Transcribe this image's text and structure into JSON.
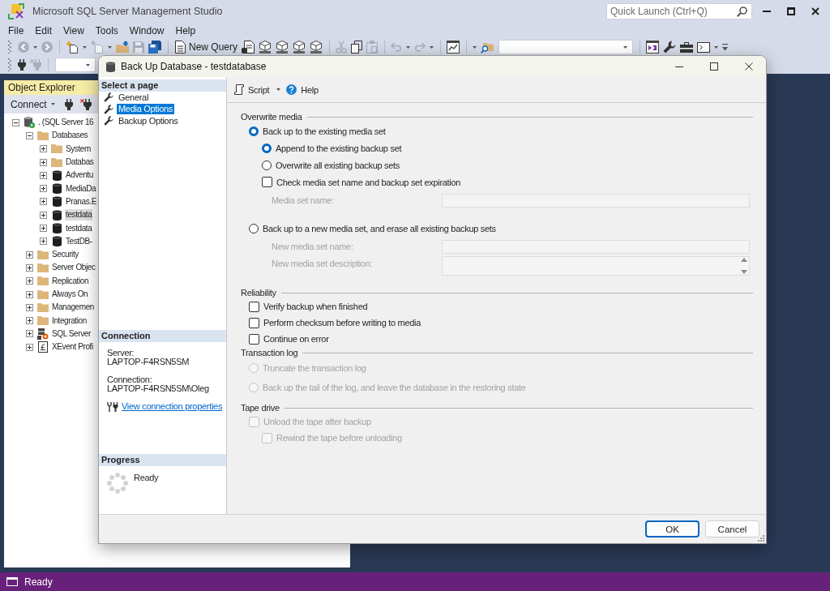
{
  "window": {
    "title": "Microsoft SQL Server Management Studio"
  },
  "quick_launch": {
    "placeholder": "Quick Launch (Ctrl+Q)"
  },
  "menu": [
    "File",
    "Edit",
    "View",
    "Tools",
    "Window",
    "Help"
  ],
  "toolbar": {
    "new_query": "New Query"
  },
  "object_explorer": {
    "title": "Object Explorer",
    "connect": "Connect",
    "tree": [
      {
        "label": ". (SQL Server 16",
        "kind": "server",
        "expanded": true,
        "selected": false,
        "children": [
          {
            "label": "Databases",
            "kind": "folder",
            "expanded": true,
            "selected": false,
            "children": [
              {
                "label": "System",
                "kind": "folder",
                "expanded": false,
                "selected": false
              },
              {
                "label": "Databas",
                "kind": "folder",
                "expanded": false,
                "selected": false
              },
              {
                "label": "Adventu",
                "kind": "database",
                "expanded": false,
                "selected": false
              },
              {
                "label": "MediaDa",
                "kind": "database",
                "expanded": false,
                "selected": false
              },
              {
                "label": "Pranas.E",
                "kind": "database",
                "expanded": false,
                "selected": false
              },
              {
                "label": "testdata",
                "kind": "database",
                "expanded": false,
                "selected": true
              },
              {
                "label": "testdata",
                "kind": "database",
                "expanded": false,
                "selected": false
              },
              {
                "label": "TestDB-",
                "kind": "database",
                "expanded": false,
                "selected": false
              }
            ]
          },
          {
            "label": "Security",
            "kind": "folder",
            "expanded": false,
            "selected": false
          },
          {
            "label": "Server Objec",
            "kind": "folder",
            "expanded": false,
            "selected": false
          },
          {
            "label": "Replication",
            "kind": "folder",
            "expanded": false,
            "selected": false
          },
          {
            "label": "Always On",
            "kind": "folder",
            "expanded": false,
            "selected": false
          },
          {
            "label": "Managemen",
            "kind": "folder",
            "expanded": false,
            "selected": false
          },
          {
            "label": "Integration",
            "kind": "folder",
            "expanded": false,
            "selected": false
          },
          {
            "label": "SQL Server",
            "kind": "agent",
            "expanded": false,
            "selected": false
          },
          {
            "label": "XEvent Profi",
            "kind": "xevent",
            "expanded": false,
            "selected": false
          }
        ]
      }
    ]
  },
  "dialog": {
    "title": "Back Up Database - testdatabase",
    "pages": {
      "heading": "Select a page",
      "items": [
        {
          "label": "General",
          "selected": false
        },
        {
          "label": "Media Options",
          "selected": true
        },
        {
          "label": "Backup Options",
          "selected": false
        }
      ]
    },
    "connection": {
      "heading": "Connection",
      "fields": [
        {
          "label": "Server:",
          "value": "LAPTOP-F4RSN5SM"
        },
        {
          "label": "Connection:",
          "value": "LAPTOP-F4RSN5SM\\Oleg"
        }
      ],
      "link": "View connection properties"
    },
    "progress": {
      "heading": "Progress",
      "status": "Ready"
    },
    "toolbar": {
      "script": "Script",
      "help": "Help"
    },
    "sections": [
      {
        "title": "Overwrite media",
        "items": [
          {
            "kind": "radio",
            "label": "Back up to the existing media set",
            "selected": true,
            "disabled": false,
            "children": [
              {
                "kind": "radio",
                "label": "Append to the existing backup set",
                "selected": true,
                "disabled": false
              },
              {
                "kind": "radio",
                "label": "Overwrite all existing backup sets",
                "selected": false,
                "disabled": false
              },
              {
                "kind": "checkbox",
                "label": "Check media set name and backup set expiration",
                "checked": false,
                "disabled": false
              },
              {
                "kind": "field",
                "label": "Media set name:",
                "disabled": true
              }
            ]
          },
          {
            "kind": "radio",
            "label": "Back up to a new media set, and erase all existing backup sets",
            "selected": false,
            "disabled": false,
            "children": [
              {
                "kind": "field",
                "label": "New media set name:",
                "disabled": true
              },
              {
                "kind": "textarea",
                "label": "New media set description:",
                "disabled": true
              }
            ]
          }
        ]
      },
      {
        "title": "Reliability",
        "items": [
          {
            "kind": "checkbox",
            "label": "Verify backup when finished",
            "checked": false,
            "disabled": false
          },
          {
            "kind": "checkbox",
            "label": "Perform checksum before writing to media",
            "checked": false,
            "disabled": false
          },
          {
            "kind": "checkbox",
            "label": "Continue on error",
            "checked": false,
            "disabled": false
          }
        ]
      },
      {
        "title": "Transaction log",
        "items": [
          {
            "kind": "radio",
            "label": "Truncate the transaction log",
            "selected": false,
            "disabled": true
          },
          {
            "kind": "radio",
            "label": "Back up the tail of the log, and leave the database in the restoring state",
            "selected": false,
            "disabled": true
          }
        ]
      },
      {
        "title": "Tape drive",
        "items": [
          {
            "kind": "checkbox",
            "label": "Unload the tape after backup",
            "checked": false,
            "disabled": true,
            "children": [
              {
                "kind": "checkbox",
                "label": "Rewind the tape before unloading",
                "checked": false,
                "disabled": true
              }
            ]
          }
        ]
      }
    ],
    "buttons": [
      {
        "label": "OK",
        "default": true
      },
      {
        "label": "Cancel",
        "default": false
      }
    ]
  },
  "status_bar": {
    "text": "Ready"
  }
}
